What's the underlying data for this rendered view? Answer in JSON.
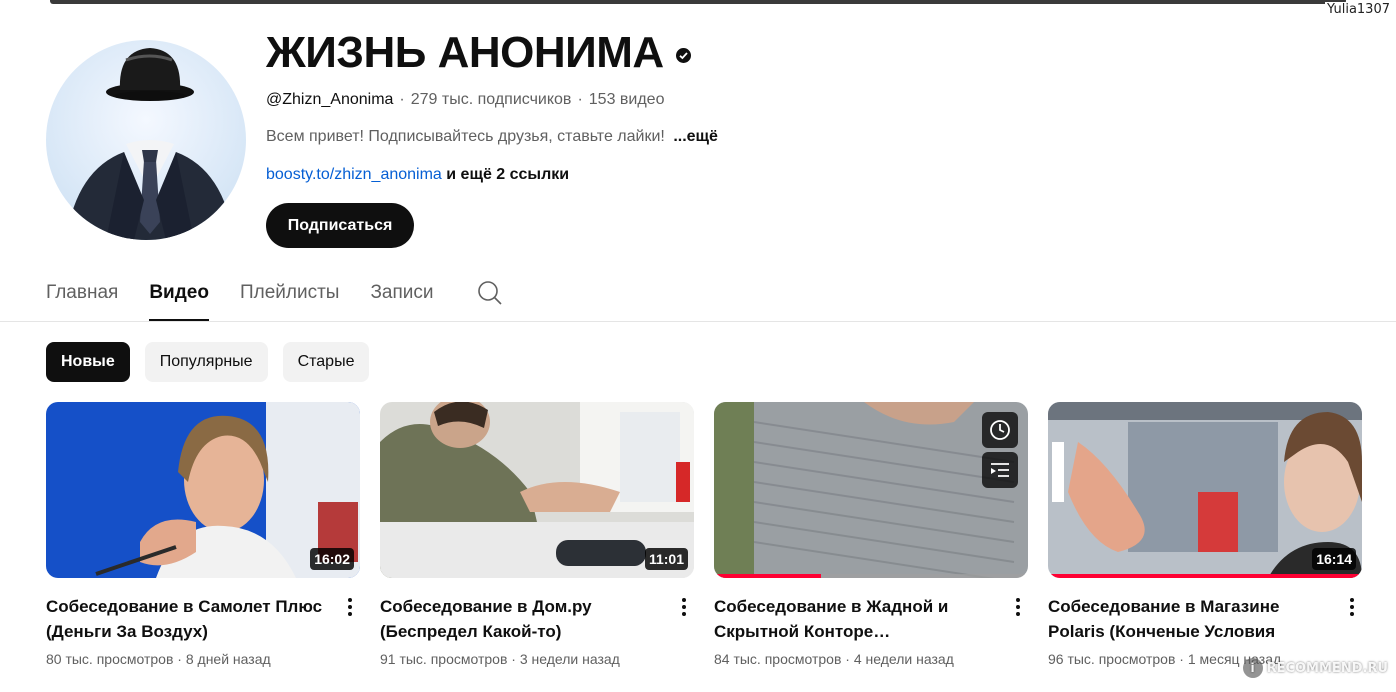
{
  "watermark_user": "Yulia1307",
  "channel": {
    "title": "ЖИЗНЬ АНОНИМА",
    "handle": "@Zhizn_Anonima",
    "subscribers": "279 тыс. подписчиков",
    "videos_count": "153 видео",
    "description": "Всем привет! Подписывайтесь друзья, ставьте лайки!",
    "more_label": "...ещё",
    "link": "boosty.to/zhizn_anonima",
    "more_links": "и ещё 2 ссылки",
    "subscribe_label": "Подписаться"
  },
  "tabs": [
    {
      "label": "Главная",
      "active": false
    },
    {
      "label": "Видео",
      "active": true
    },
    {
      "label": "Плейлисты",
      "active": false
    },
    {
      "label": "Записи",
      "active": false
    }
  ],
  "chips": [
    {
      "label": "Новые",
      "active": true
    },
    {
      "label": "Популярные",
      "active": false
    },
    {
      "label": "Старые",
      "active": false
    }
  ],
  "videos": [
    {
      "title": "Собеседование в Самолет Плюс (Деньги За Воздух)",
      "duration": "16:02",
      "views": "80 тыс. просмотров",
      "age": "8 дней назад",
      "watched_fraction": 0
    },
    {
      "title": "Собеседование в Дом.ру (Беспредел Какой-то)",
      "duration": "11:01",
      "views": "91 тыс. просмотров",
      "age": "3 недели назад",
      "watched_fraction": 0
    },
    {
      "title": "Собеседование в Жадной и Скрытной Конторе…",
      "duration": "",
      "views": "84 тыс. просмотров",
      "age": "4 недели назад",
      "watched_fraction": 0.34
    },
    {
      "title": "Собеседование в Магазине Polaris (Конченые Условия Труда)",
      "duration": "16:14",
      "views": "96 тыс. просмотров",
      "age": "1 месяц назад",
      "watched_fraction": 1.0
    }
  ],
  "watermark_site": "RECOMMEND.RU",
  "colors": {
    "accent_red": "#ff0033",
    "link_blue": "#065fd4",
    "text_primary": "#0f0f0f",
    "text_secondary": "#606060"
  }
}
